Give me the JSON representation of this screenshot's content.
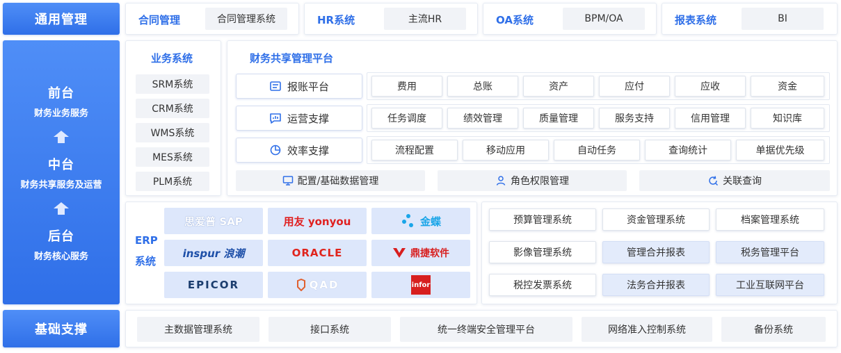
{
  "left": {
    "top": "通用管理",
    "front": {
      "title": "前台",
      "subtitle": "财务业务服务"
    },
    "middle": {
      "title": "中台",
      "subtitle": "财务共享服务及运营"
    },
    "back": {
      "title": "后台",
      "subtitle": "财务核心服务"
    },
    "bottom": "基础支撑"
  },
  "general": [
    {
      "label": "合同管理",
      "value": "合同管理系统"
    },
    {
      "label": "HR系统",
      "value": "主流HR"
    },
    {
      "label": "OA系统",
      "value": "BPM/OA"
    },
    {
      "label": "报表系统",
      "value": "BI"
    }
  ],
  "business": {
    "title": "业务系统",
    "items": [
      "SRM系统",
      "CRM系统",
      "WMS系统",
      "MES系统",
      "PLM系统"
    ]
  },
  "platform": {
    "title": "财务共享管理平台",
    "rows": [
      {
        "label": "报账平台",
        "icon": "receipt-icon",
        "items": [
          "费用",
          "总账",
          "资产",
          "应付",
          "应收",
          "资金"
        ]
      },
      {
        "label": "运营支撑",
        "icon": "chat-chart-icon",
        "items": [
          "任务调度",
          "绩效管理",
          "质量管理",
          "服务支持",
          "信用管理",
          "知识库"
        ]
      },
      {
        "label": "效率支撑",
        "icon": "pie-icon",
        "items": [
          "流程配置",
          "移动应用",
          "自动任务",
          "查询统计",
          "单据优先级"
        ]
      }
    ],
    "bottom": [
      {
        "label": "配置/基础数据管理",
        "icon": "monitor-icon"
      },
      {
        "label": "角色权限管理",
        "icon": "user-icon"
      },
      {
        "label": "关联查询",
        "icon": "search-refresh-icon"
      }
    ]
  },
  "erp": {
    "title": "ERP\n系统",
    "logos": [
      "思爱普 SAP",
      "用友 yonyou",
      "金蝶",
      "inspur 浪潮",
      "ORACLE",
      "鼎捷软件",
      "EPICOR",
      "QAD",
      "infor"
    ]
  },
  "back_systems": {
    "rows": [
      [
        "预算管理系统",
        "资金管理系统",
        "档案管理系统"
      ],
      [
        "影像管理系统",
        "管理合并报表",
        "税务管理平台"
      ],
      [
        "税控发票系统",
        "法务合并报表",
        "工业互联网平台"
      ]
    ]
  },
  "foundation": [
    "主数据管理系统",
    "接口系统",
    "统一终端安全管理平台",
    "网络准入控制系统",
    "备份系统"
  ],
  "colors": {
    "accent": "#2f6fe8",
    "light_blue": "#e3ebfb",
    "grey": "#f1f3f7"
  }
}
